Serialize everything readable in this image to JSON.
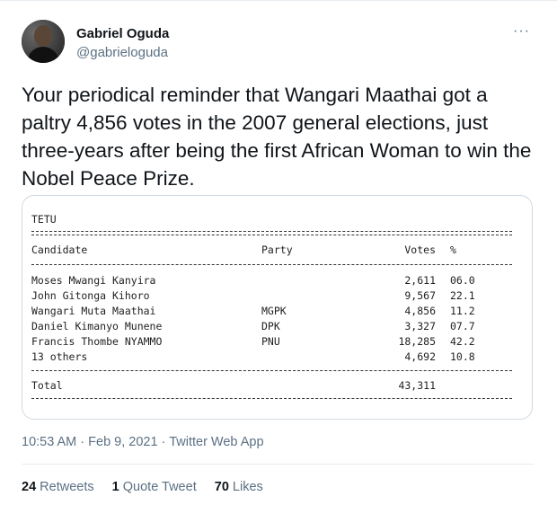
{
  "author": {
    "name": "Gabriel Oguda",
    "handle": "@gabrieloguda"
  },
  "more_label": "···",
  "tweet_text": "Your periodical reminder that Wangari Maathai got a paltry 4,856 votes in the 2007 general elections, just three-years after being the first African Woman to win the Nobel Peace Prize.",
  "results": {
    "constituency": "TETU",
    "headers": {
      "candidate": "Candidate",
      "party": "Party",
      "votes": "Votes",
      "pct": "%"
    },
    "rows": [
      {
        "candidate": "Moses Mwangi Kanyira",
        "party": "",
        "votes": "2,611",
        "pct": "06.0"
      },
      {
        "candidate": "John Gitonga Kihoro",
        "party": "",
        "votes": "9,567",
        "pct": "22.1"
      },
      {
        "candidate": "Wangari Muta Maathai",
        "party": "MGPK",
        "votes": "4,856",
        "pct": "11.2"
      },
      {
        "candidate": "Daniel Kimanyo Munene",
        "party": "DPK",
        "votes": "3,327",
        "pct": "07.7"
      },
      {
        "candidate": "Francis Thombe NYAMMO",
        "party": "PNU",
        "votes": "18,285",
        "pct": "42.2"
      },
      {
        "candidate": "13 others",
        "party": "",
        "votes": "4,692",
        "pct": "10.8"
      }
    ],
    "total_label": "Total",
    "total_votes": "43,311"
  },
  "meta": {
    "time": "10:53 AM",
    "date": "Feb 9, 2021",
    "source": "Twitter Web App"
  },
  "stats": {
    "retweets_count": "24",
    "retweets_label": "Retweets",
    "quotes_count": "1",
    "quotes_label": "Quote Tweet",
    "likes_count": "70",
    "likes_label": "Likes"
  }
}
